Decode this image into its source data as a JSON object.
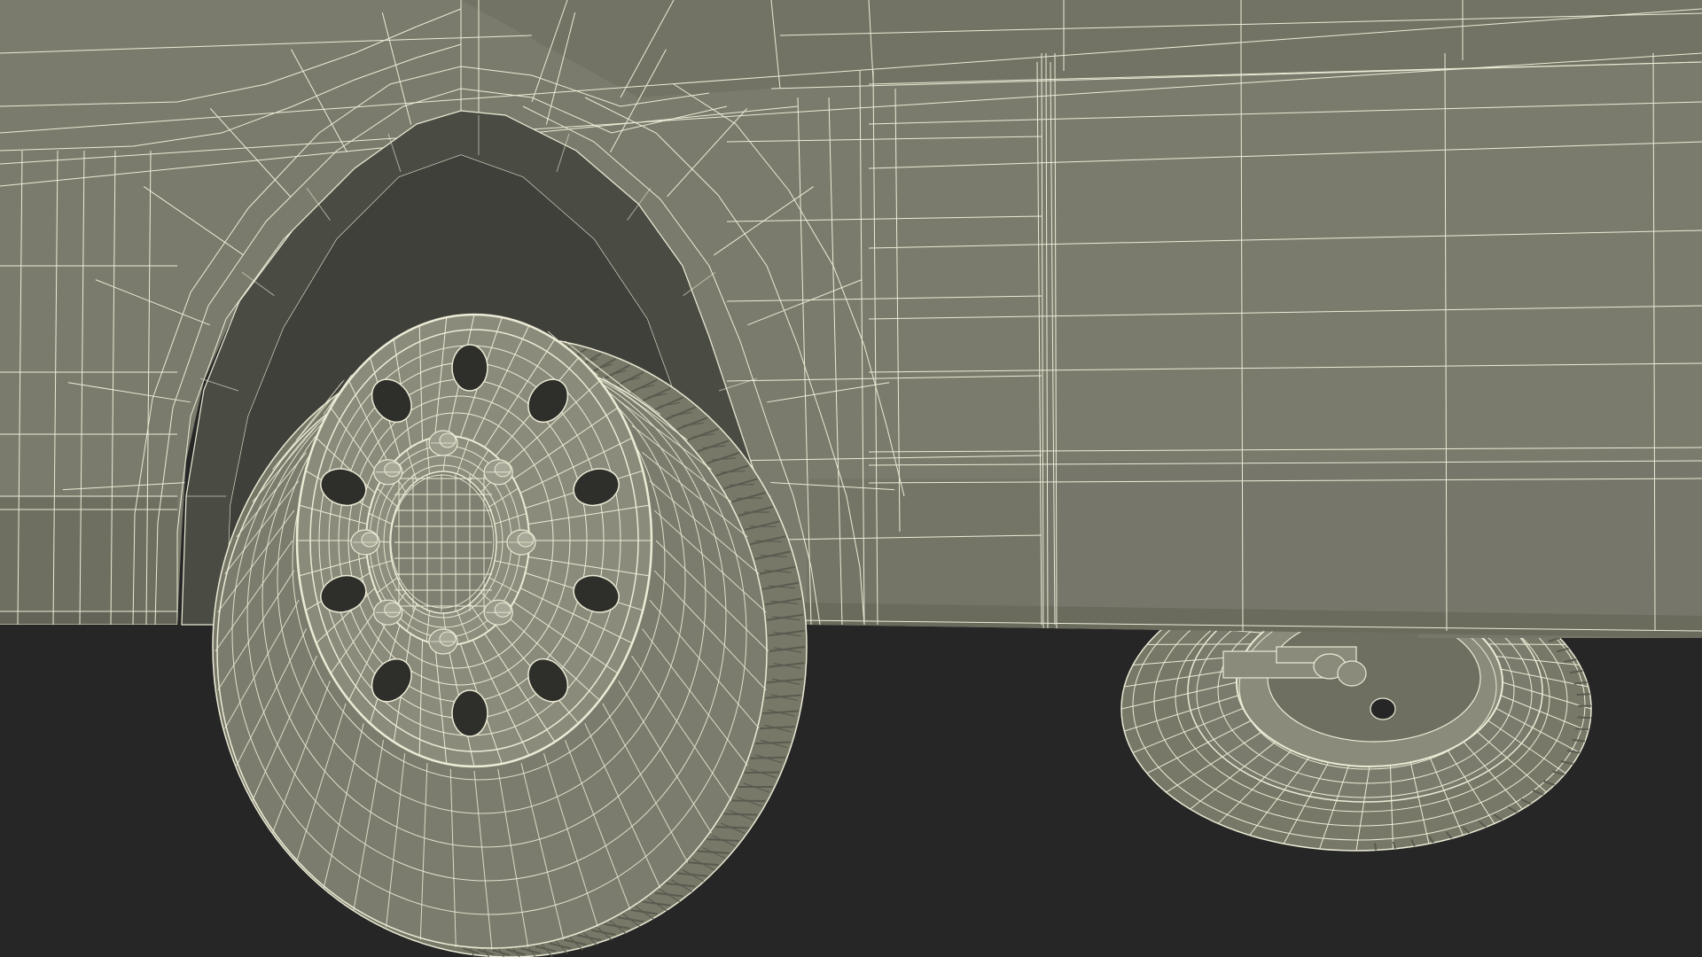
{
  "scene": {
    "colors": {
      "background": "#262626",
      "surface": "#7a7b6c",
      "surface_dark": "#6e6f61",
      "surface_shadow": "#5f6055",
      "wheel_well": "#4a4b43",
      "tire": "#777867",
      "tire_tread": "#6b6c5d",
      "rim": "#8a8b7b",
      "wire": "#ecebd6",
      "wire_dim": "#d8d7c2"
    },
    "elements": [
      "van-body-panel",
      "wheel-arch",
      "front-wheel",
      "rear-wheel",
      "wireframe-mesh"
    ]
  }
}
